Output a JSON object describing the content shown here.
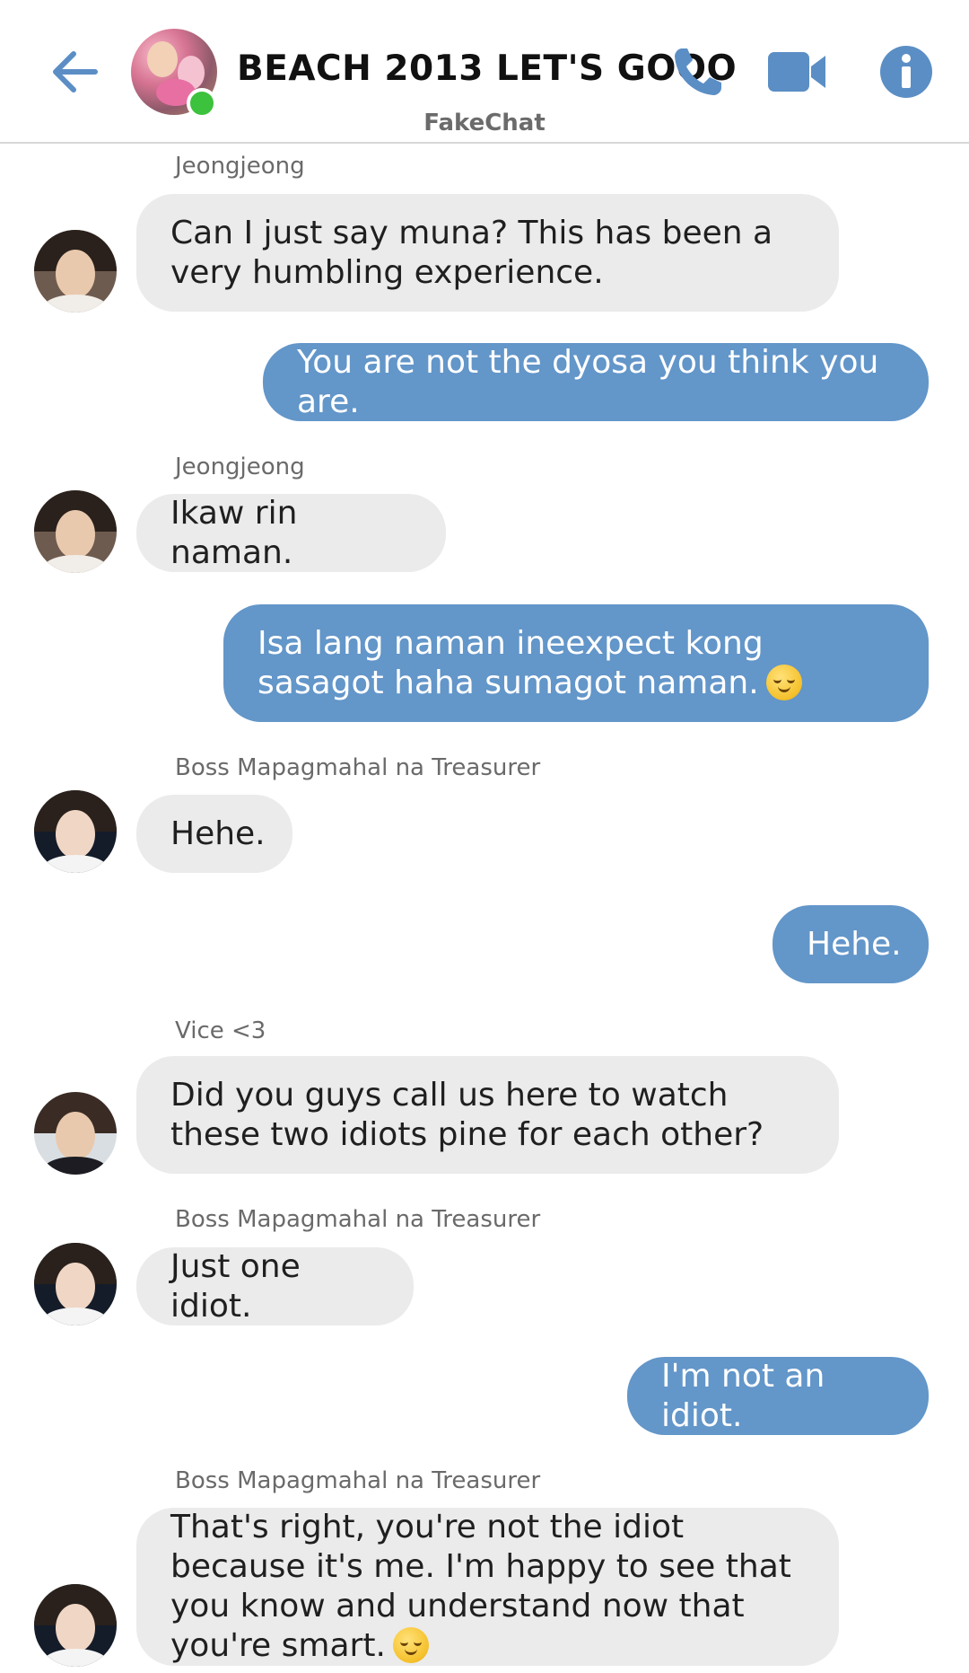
{
  "header": {
    "title": "BEACH 2013 LET'S GOOO",
    "app_name": "FakeChat",
    "accent_color": "#5b8ec5",
    "icons": [
      "back-arrow-icon",
      "phone-icon",
      "video-camera-icon",
      "info-icon"
    ]
  },
  "messages": [
    {
      "sender": "Jeongjeong",
      "direction": "in",
      "text": "Can I just say muna? This has been a very humbling experience."
    },
    {
      "direction": "out",
      "text": "You are not the dyosa you think you are."
    },
    {
      "sender": "Jeongjeong",
      "direction": "in",
      "text": "Ikaw rin naman."
    },
    {
      "direction": "out",
      "text": "Isa lang naman ineexpect kong sasagot haha sumagot naman.",
      "emoji": "relieved-face"
    },
    {
      "sender": "Boss Mapagmahal na Treasurer",
      "direction": "in",
      "text": "Hehe."
    },
    {
      "direction": "out",
      "text": "Hehe."
    },
    {
      "sender": "Vice <3",
      "direction": "in",
      "text": "Did you guys call us here to watch these two idiots pine for each other?"
    },
    {
      "sender": "Boss Mapagmahal na Treasurer",
      "direction": "in",
      "text": "Just one idiot."
    },
    {
      "direction": "out",
      "text": "I'm not an idiot."
    },
    {
      "sender": "Boss Mapagmahal na Treasurer",
      "direction": "in",
      "text": "That's right, you're not the idiot because it's me. I'm happy to see that you know and understand now that you're smart.",
      "emoji": "smiling-face"
    }
  ],
  "colors": {
    "incoming_bubble": "#ebebeb",
    "outgoing_bubble": "#6396c9",
    "online_dot": "#3cc23c"
  }
}
